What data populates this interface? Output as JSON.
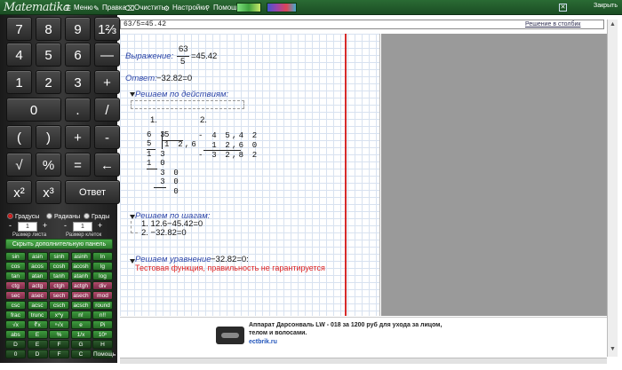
{
  "toolbar": {
    "logo": "Matematika",
    "menu": "Меню",
    "edit": "Правка",
    "clear": "Очистить",
    "settings": "Настройки",
    "help": "Помощь",
    "close": "Закрыть",
    "swatch_colors": [
      "#3fa33f",
      "#9944aa"
    ]
  },
  "keypad": {
    "keys": [
      "7",
      "8",
      "9",
      "1⅔",
      "4",
      "5",
      "6",
      "—",
      "1",
      "2",
      "3",
      "+",
      "0",
      ".",
      "/",
      "(",
      ")",
      "+",
      "-",
      "√",
      "%",
      "=",
      "←",
      "x²",
      "x³",
      "Ответ"
    ],
    "angle_modes": [
      "Градусы",
      "Радианы",
      "Грады"
    ],
    "selected_angle": "Градусы",
    "sheet_size_label": "Размер листа",
    "sheet_size_value": "1",
    "cell_size_label": "Размер клеток",
    "cell_size_value": "1",
    "hide_panel": "Скрыть дополнительную панель",
    "functions": [
      "sin",
      "asin",
      "sinh",
      "asinh",
      "ln",
      "cos",
      "acos",
      "cosh",
      "acosh",
      "lg",
      "tan",
      "atan",
      "tanh",
      "atanh",
      "log",
      "ctg",
      "actg",
      "ctgh",
      "actgh",
      "div",
      "sec",
      "asec",
      "sech",
      "asech",
      "mod",
      "csc",
      "acsc",
      "csch",
      "acsch",
      "round",
      "frac",
      "trunc",
      "x^y",
      "n!",
      "n!!",
      "√x",
      "∛x",
      "ⁿ√x",
      "e",
      "Pi",
      "abs",
      "E",
      "%",
      "1/x",
      "10ˣ",
      "D",
      "E",
      "F",
      "G",
      "H",
      "0",
      "D",
      "F",
      "C",
      "Помощь"
    ]
  },
  "input": {
    "expression": "63/5=45.42",
    "column_button": "Решение в столбик"
  },
  "worksheet": {
    "expression_label": "Выражение:",
    "numerator": "63",
    "denominator": "5",
    "equals_value": "=45.42",
    "answer_label": "Ответ:",
    "answer_value": "−32.82=0",
    "by_actions_label": "Решаем по действиям:",
    "step1_num": "1.",
    "step2_num": "2.",
    "div_rows": [
      "6 3",
      "5",
      "1 3",
      "1 0",
      "  3 0",
      "  3 0",
      "    0"
    ],
    "div_divisor": "5",
    "div_quotient": "1 2,6",
    "sub_rows": [
      "- 4 5,4 2",
      "  1 2,6 0",
      "- 3 2,8 2"
    ],
    "by_steps_label": "Решаем по шагам:",
    "step_line1": "1. 12.6−45.42=0",
    "step_line2": "2. −32.82=0",
    "equation_label": "Решаем уравнение",
    "equation_value": "−32.82=0:",
    "warning": "Тестовая функция, правильность не гарантируется"
  },
  "ad": {
    "title": "Аппарат Дарсонваль LW - 018 за 1200 руб для ухода за лицом, телом и волосами.",
    "link": "ectbrik.ru"
  }
}
